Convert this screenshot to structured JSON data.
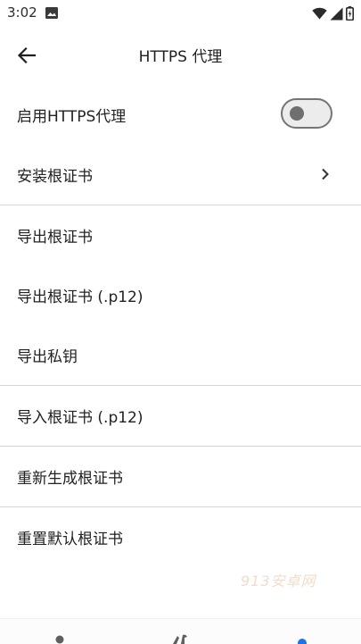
{
  "status_bar": {
    "time": "3:02",
    "icons": [
      "image-icon",
      "wifi-icon",
      "signal-icon",
      "battery-icon"
    ]
  },
  "app_bar": {
    "title": "HTTPS 代理",
    "back_icon": "arrow-left-icon"
  },
  "settings": {
    "enable_https_proxy": {
      "label": "启用HTTPS代理",
      "enabled": false
    },
    "install_root_cert": {
      "label": "安装根证书"
    },
    "export_root_cert": {
      "label": "导出根证书"
    },
    "export_root_cert_p12": {
      "label": "导出根证书 (.p12)"
    },
    "export_private_key": {
      "label": "导出私钥"
    },
    "import_root_cert_p12": {
      "label": "导入根证书 (.p12)"
    },
    "regenerate_root_cert": {
      "label": "重新生成根证书"
    },
    "reset_default_root_cert": {
      "label": "重置默认根证书"
    }
  },
  "watermark": "913安卓网",
  "colors": {
    "divider": "#d6d6d6",
    "toggle_off_track": "#ececec",
    "toggle_off_knob": "#6f6f6f",
    "text": "#222222",
    "nav_active": "#1a73e8"
  },
  "bottom_nav": {
    "icons": [
      "person-icon",
      "tools-icon",
      "active-tab-icon"
    ]
  }
}
